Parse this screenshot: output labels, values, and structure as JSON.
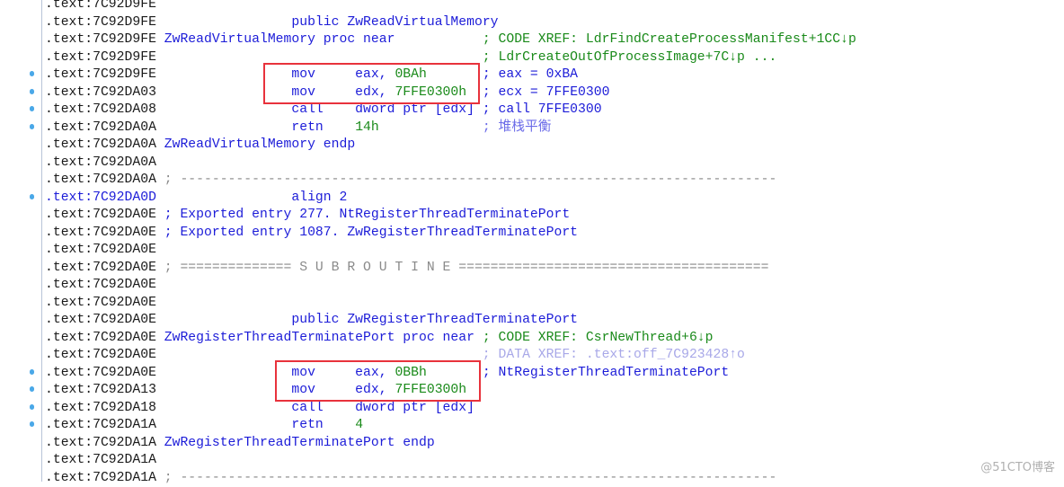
{
  "colors": {
    "address": "#1a1a1a",
    "name_blue": "#1c1cd8",
    "value_green": "#1a8a1a",
    "highlight_box": "#e8323c",
    "breakpoint_dot": "#4aa8e8"
  },
  "lines": [
    {
      "addr": ".text:7C92D9FE",
      "dot": false,
      "parts": []
    },
    {
      "addr": ".text:7C92D9FE",
      "dot": false,
      "parts": [
        {
          "t": "                public ",
          "c": "b"
        },
        {
          "t": "ZwReadVirtualMemory",
          "c": "b"
        }
      ]
    },
    {
      "addr": ".text:7C92D9FE",
      "dot": false,
      "parts": [
        {
          "t": "ZwReadVirtualMemory proc near",
          "c": "b"
        },
        {
          "t": "           ; CODE XREF: LdrFindCreateProcessManifest+1CC↓p",
          "c": "c"
        }
      ]
    },
    {
      "addr": ".text:7C92D9FE",
      "dot": false,
      "parts": [
        {
          "t": "                                        ; LdrCreateOutOfProcessImage+7C↓p ...",
          "c": "c"
        }
      ]
    },
    {
      "addr": ".text:7C92D9FE",
      "dot": true,
      "parts": [
        {
          "t": "                mov     eax, ",
          "c": "b"
        },
        {
          "t": "0BAh",
          "c": "g"
        },
        {
          "t": "       ; eax = 0xBA",
          "c": "b"
        }
      ]
    },
    {
      "addr": ".text:7C92DA03",
      "dot": true,
      "parts": [
        {
          "t": "                mov     edx, ",
          "c": "b"
        },
        {
          "t": "7FFE0300h",
          "c": "g"
        },
        {
          "t": "  ; ecx = 7FFE0300",
          "c": "b"
        }
      ]
    },
    {
      "addr": ".text:7C92DA08",
      "dot": true,
      "parts": [
        {
          "t": "                call    dword ptr [edx] ; call 7FFE0300",
          "c": "b"
        }
      ]
    },
    {
      "addr": ".text:7C92DA0A",
      "dot": true,
      "parts": [
        {
          "t": "                retn    ",
          "c": "b"
        },
        {
          "t": "14h",
          "c": "g"
        },
        {
          "t": "             ; 堆栈平衡",
          "c": "lb"
        }
      ]
    },
    {
      "addr": ".text:7C92DA0A",
      "dot": false,
      "parts": [
        {
          "t": "ZwReadVirtualMemory endp",
          "c": "b"
        }
      ]
    },
    {
      "addr": ".text:7C92DA0A",
      "dot": false,
      "parts": []
    },
    {
      "addr": ".text:7C92DA0A",
      "dot": false,
      "parts": [
        {
          "t": "; ---------------------------------------------------------------------------",
          "c": "s"
        }
      ]
    },
    {
      "addr": ".text:7C92DA0D",
      "addr_blue": true,
      "dot": true,
      "parts": [
        {
          "t": "                align 2",
          "c": "b"
        }
      ]
    },
    {
      "addr": ".text:7C92DA0E",
      "dot": false,
      "parts": [
        {
          "t": "; Exported entry 277. NtRegisterThreadTerminatePort",
          "c": "b"
        }
      ]
    },
    {
      "addr": ".text:7C92DA0E",
      "dot": false,
      "parts": [
        {
          "t": "; Exported entry 1087. ZwRegisterThreadTerminatePort",
          "c": "b"
        }
      ]
    },
    {
      "addr": ".text:7C92DA0E",
      "dot": false,
      "parts": []
    },
    {
      "addr": ".text:7C92DA0E",
      "dot": false,
      "parts": [
        {
          "t": "; ============== S U B R O U T I N E =======================================",
          "c": "s"
        }
      ]
    },
    {
      "addr": ".text:7C92DA0E",
      "dot": false,
      "parts": []
    },
    {
      "addr": ".text:7C92DA0E",
      "dot": false,
      "parts": []
    },
    {
      "addr": ".text:7C92DA0E",
      "dot": false,
      "parts": [
        {
          "t": "                public ZwRegisterThreadTerminatePort",
          "c": "b"
        }
      ]
    },
    {
      "addr": ".text:7C92DA0E",
      "dot": false,
      "parts": [
        {
          "t": "ZwRegisterThreadTerminatePort proc near",
          "c": "b"
        },
        {
          "t": " ; CODE XREF: CsrNewThread+6↓p",
          "c": "c"
        }
      ]
    },
    {
      "addr": ".text:7C92DA0E",
      "dot": false,
      "parts": [
        {
          "t": "                                        ; DATA XREF: .text:off_7C923428↑o",
          "c": "p"
        }
      ]
    },
    {
      "addr": ".text:7C92DA0E",
      "dot": true,
      "parts": [
        {
          "t": "                mov     eax, ",
          "c": "b"
        },
        {
          "t": "0BBh",
          "c": "g"
        },
        {
          "t": "       ; NtRegisterThreadTerminatePort",
          "c": "b"
        }
      ]
    },
    {
      "addr": ".text:7C92DA13",
      "dot": true,
      "parts": [
        {
          "t": "                mov     edx, ",
          "c": "b"
        },
        {
          "t": "7FFE0300h",
          "c": "g"
        }
      ]
    },
    {
      "addr": ".text:7C92DA18",
      "dot": true,
      "parts": [
        {
          "t": "                call    dword ptr [edx]",
          "c": "b"
        }
      ]
    },
    {
      "addr": ".text:7C92DA1A",
      "dot": true,
      "parts": [
        {
          "t": "                retn    ",
          "c": "b"
        },
        {
          "t": "4",
          "c": "g"
        }
      ]
    },
    {
      "addr": ".text:7C92DA1A",
      "dot": false,
      "parts": [
        {
          "t": "ZwRegisterThreadTerminatePort endp",
          "c": "b"
        }
      ]
    },
    {
      "addr": ".text:7C92DA1A",
      "dot": false,
      "parts": []
    },
    {
      "addr": ".text:7C92DA1A",
      "dot": false,
      "parts": [
        {
          "t": "; ---------------------------------------------------------------------------",
          "c": "s"
        }
      ]
    }
  ],
  "watermark": "@51CTO博客"
}
